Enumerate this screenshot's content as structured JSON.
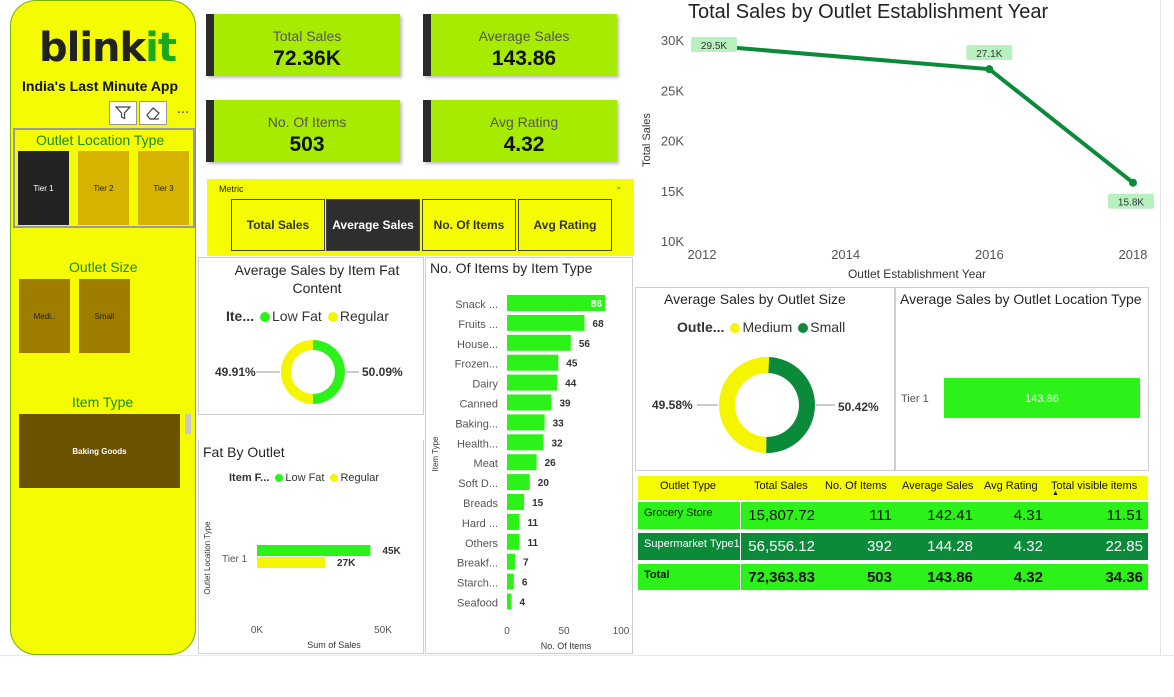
{
  "colors": {
    "accent_yellow": "#f5fb00",
    "kpi_green": "#a7ec00",
    "bright_green": "#2df21a",
    "dark_green": "#0b8a3a",
    "line_green": "#0b8a3a",
    "dark_tile": "#2e2e2e",
    "low_fat": "#2df21a",
    "regular": "#f5f500"
  },
  "sidebar": {
    "logo_main": "blink",
    "logo_accent": "it",
    "tagline": "India's Last Minute App",
    "tools": [
      {
        "icon": "filter-icon"
      },
      {
        "icon": "eraser-icon"
      },
      {
        "icon": "more-options-icon",
        "glyph": "···"
      }
    ],
    "outlet_location": {
      "title": "Outlet Location Type",
      "items": [
        {
          "label": "Tier 1",
          "color": "#232323",
          "selected": true
        },
        {
          "label": "Tier 2",
          "color": "#d6b300"
        },
        {
          "label": "Tier 3",
          "color": "#d6b300"
        }
      ]
    },
    "outlet_size": {
      "title": "Outlet Size",
      "items": [
        {
          "label": "Medi..",
          "color": "#9e7d00"
        },
        {
          "label": "Small",
          "color": "#9e7d00"
        }
      ]
    },
    "item_type": {
      "title": "Item Type",
      "items": [
        {
          "label": "Baking Goods",
          "color": "#6a5200"
        }
      ]
    }
  },
  "kpis": [
    {
      "label": "Total Sales",
      "value": "72.36K"
    },
    {
      "label": "Average Sales",
      "value": "143.86"
    },
    {
      "label": "No. Of Items",
      "value": "503"
    },
    {
      "label": "Avg Rating",
      "value": "4.32"
    }
  ],
  "metric": {
    "label": "Metric",
    "chevron": "⌄",
    "buttons": [
      {
        "label": "Total Sales"
      },
      {
        "label": "Average Sales",
        "active": true
      },
      {
        "label": "No. Of Items"
      },
      {
        "label": "Avg Rating"
      }
    ]
  },
  "fat_content": {
    "title": "Average Sales by Item Fat Content",
    "legend_prefix": "Ite...",
    "legend": [
      "Low Fat",
      "Regular"
    ]
  },
  "fat_by_outlet": {
    "title": "Fat By Outlet",
    "legend_prefix": "Item F...",
    "legend": [
      "Low Fat",
      "Regular"
    ]
  },
  "items_by_type": {
    "title": "No. Of Items by Item Type"
  },
  "outlet_size_panel": {
    "title": "Average Sales by Outlet Size",
    "legend_prefix": "Outle...",
    "legend": [
      "Medium",
      "Small"
    ]
  },
  "outlet_location_panel": {
    "title": "Average Sales by Outlet Location Type"
  },
  "line_chart": {
    "title": "Total Sales by Outlet Establishment Year"
  },
  "table": {
    "columns": [
      "Outlet Type",
      "Total Sales",
      "No. Of Items",
      "Average Sales",
      "Avg Rating",
      "Total visible items"
    ],
    "sort_indicator": "▲",
    "rows": [
      {
        "type": "Grocery Store",
        "cells": [
          "15,807.72",
          "111",
          "142.41",
          "4.31",
          "11.51"
        ]
      },
      {
        "type": "Supermarket Type1",
        "cells": [
          "56,556.12",
          "392",
          "144.28",
          "4.32",
          "22.85"
        ]
      }
    ],
    "total": {
      "type": "Total",
      "cells": [
        "72,363.83",
        "503",
        "143.86",
        "4.32",
        "34.36"
      ]
    }
  },
  "chart_data": [
    {
      "type": "line",
      "title": "Total Sales by Outlet Establishment Year",
      "xlabel": "Outlet Establishment Year",
      "ylabel": "Total Sales",
      "x": [
        2012,
        2016,
        2018
      ],
      "x_ticks": [
        "2012",
        "2014",
        "2016",
        "2018"
      ],
      "y": [
        29.5,
        27.1,
        15.8
      ],
      "data_labels": [
        "29.5K",
        "27.1K",
        "15.8K"
      ],
      "y_ticks": [
        "10K",
        "15K",
        "20K",
        "25K",
        "30K"
      ],
      "ylim": [
        10,
        30
      ],
      "xlim": [
        2012,
        2018
      ],
      "color": "#0b8a3a"
    },
    {
      "type": "pie",
      "title": "Average Sales by Item Fat Content",
      "labels": [
        "Low Fat",
        "Regular"
      ],
      "values": [
        50.09,
        49.91
      ],
      "data_labels": [
        "50.09%",
        "49.91%"
      ],
      "colors": [
        "#2df21a",
        "#f5f500"
      ]
    },
    {
      "type": "bar",
      "title": "Fat By Outlet",
      "xlabel": "Sum of Sales",
      "ylabel": "Outlet Location Type",
      "categories": [
        "Tier 1"
      ],
      "series": [
        {
          "name": "Low Fat",
          "values": [
            45
          ],
          "data_labels": [
            "45K"
          ],
          "color": "#2df21a"
        },
        {
          "name": "Regular",
          "values": [
            27
          ],
          "data_labels": [
            "27K"
          ],
          "color": "#f5f500"
        }
      ],
      "x_ticks": [
        "0K",
        "50K"
      ],
      "xlim": [
        0,
        50
      ]
    },
    {
      "type": "bar",
      "title": "No. Of Items by Item Type",
      "xlabel": "No. Of Items",
      "ylabel": "Item Type",
      "categories": [
        "Snack ...",
        "Fruits ...",
        "House...",
        "Frozen...",
        "Dairy",
        "Canned",
        "Baking...",
        "Health...",
        "Meat",
        "Soft D...",
        "Breads",
        "Hard ...",
        "Others",
        "Breakf...",
        "Starch...",
        "Seafood"
      ],
      "values": [
        86,
        68,
        56,
        45,
        44,
        39,
        33,
        32,
        26,
        20,
        15,
        11,
        11,
        7,
        6,
        4
      ],
      "x_ticks": [
        "0",
        "50",
        "100"
      ],
      "xlim": [
        0,
        100
      ],
      "color": "#2df21a"
    },
    {
      "type": "pie",
      "title": "Average Sales by Outlet Size",
      "labels": [
        "Medium",
        "Small"
      ],
      "values": [
        50.42,
        49.58
      ],
      "data_labels": [
        "50.42%",
        "49.58%"
      ],
      "colors": [
        "#f5f500",
        "#0b8a3a"
      ]
    },
    {
      "type": "bar",
      "title": "Average Sales by Outlet Location Type",
      "categories": [
        "Tier 1"
      ],
      "values": [
        143.86
      ],
      "data_labels": [
        "143.86"
      ],
      "color": "#2df21a"
    }
  ]
}
